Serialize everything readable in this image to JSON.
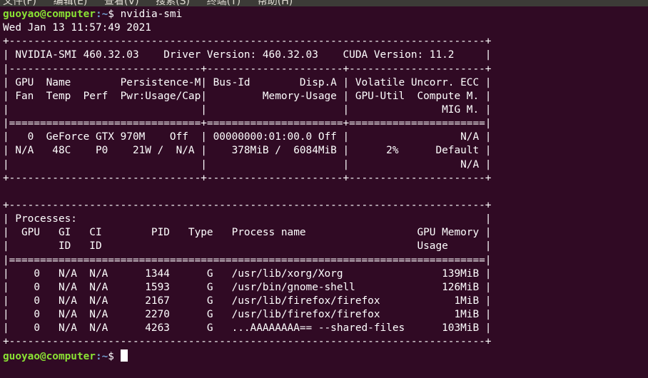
{
  "menu": {
    "items": [
      "文件(F)",
      "编辑(E)",
      "查看(V)",
      "搜索(S)",
      "终端(T)",
      "帮助(H)"
    ]
  },
  "prompt": {
    "user_host": "guoyao@computer",
    "path": ":~",
    "symbol": "$ "
  },
  "command": "nvidia-smi",
  "date_line": "Wed Jan 13 11:57:49 2021",
  "output_lines": [
    "+-----------------------------------------------------------------------------+",
    "| NVIDIA-SMI 460.32.03    Driver Version: 460.32.03    CUDA Version: 11.2     |",
    "|-------------------------------+----------------------+----------------------+",
    "| GPU  Name        Persistence-M| Bus-Id        Disp.A | Volatile Uncorr. ECC |",
    "| Fan  Temp  Perf  Pwr:Usage/Cap|         Memory-Usage | GPU-Util  Compute M. |",
    "|                               |                      |               MIG M. |",
    "|===============================+======================+======================|",
    "|   0  GeForce GTX 970M    Off  | 00000000:01:00.0 Off |                  N/A |",
    "| N/A   48C    P0    21W /  N/A |    378MiB /  6084MiB |      2%      Default |",
    "|                               |                      |                  N/A |",
    "+-------------------------------+----------------------+----------------------+",
    "",
    "+-----------------------------------------------------------------------------+",
    "| Processes:                                                                  |",
    "|  GPU   GI   CI        PID   Type   Process name                  GPU Memory |",
    "|        ID   ID                                                   Usage      |",
    "|=============================================================================|",
    "|    0   N/A  N/A      1344      G   /usr/lib/xorg/Xorg                139MiB |",
    "|    0   N/A  N/A      1593      G   /usr/bin/gnome-shell              126MiB |",
    "|    0   N/A  N/A      2167      G   /usr/lib/firefox/firefox            1MiB |",
    "|    0   N/A  N/A      2270      G   /usr/lib/firefox/firefox            1MiB |",
    "|    0   N/A  N/A      4263      G   ...AAAAAAAA== --shared-files      103MiB |",
    "+-----------------------------------------------------------------------------+"
  ],
  "colors": {
    "background": "#300a24",
    "text": "#ffffff",
    "prompt_user": "#8ae234",
    "prompt_path": "#729fcf"
  }
}
